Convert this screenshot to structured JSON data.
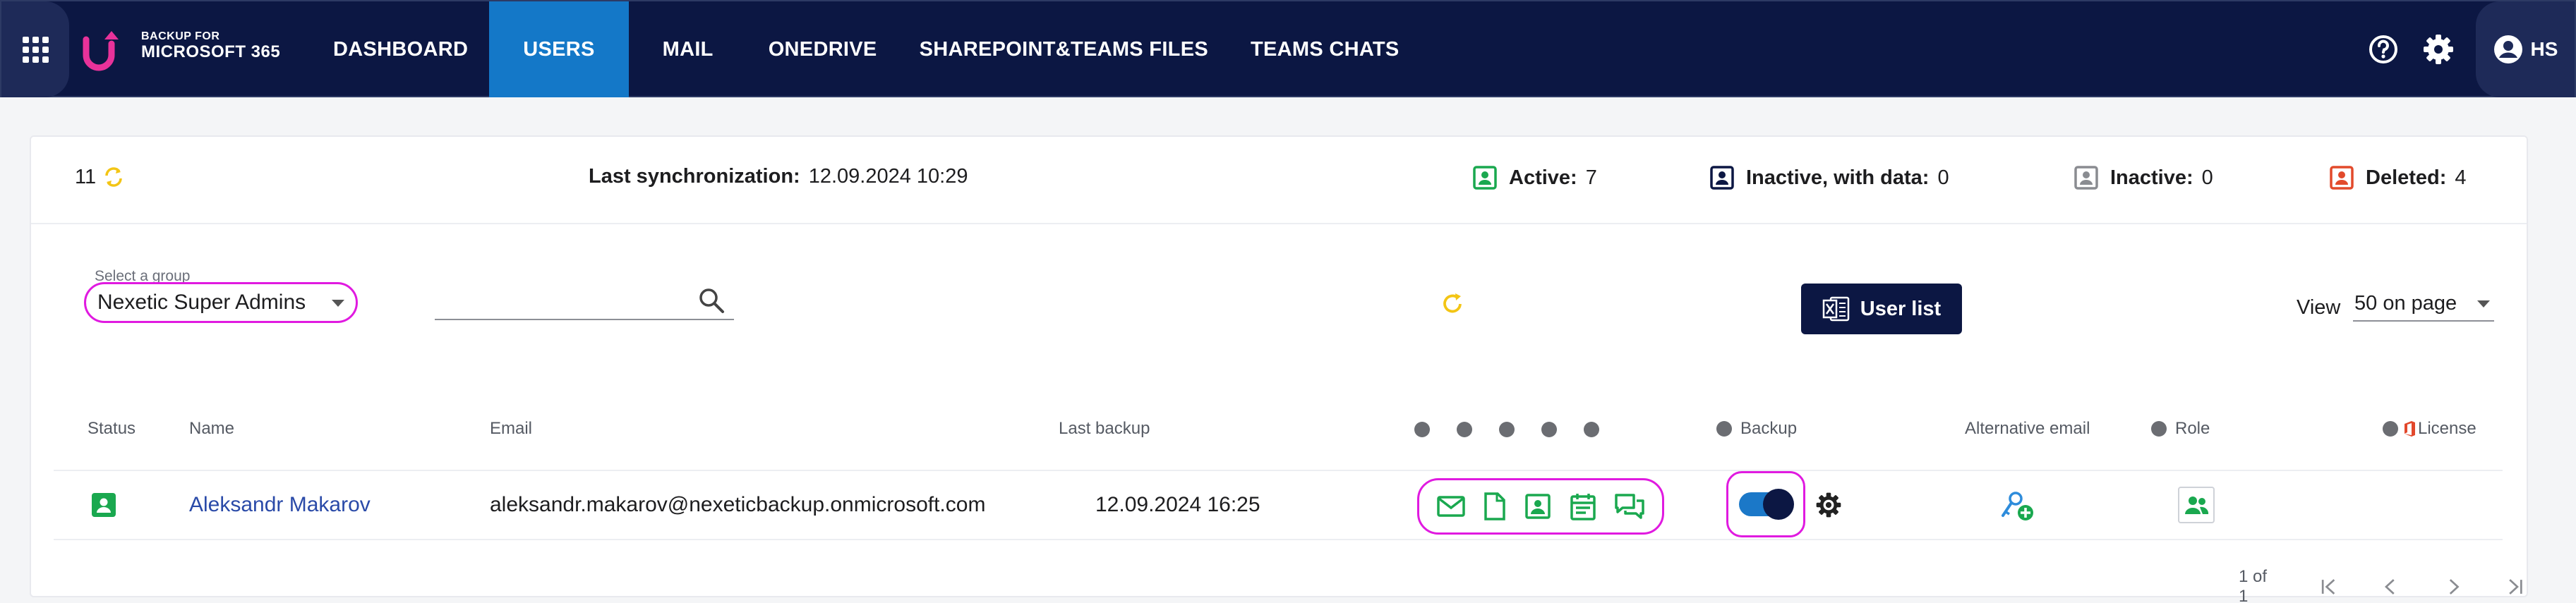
{
  "nav": {
    "brand_line1": "BACKUP FOR",
    "brand_line2": "MICROSOFT 365",
    "items": [
      {
        "label": "DASHBOARD",
        "active": false
      },
      {
        "label": "USERS",
        "active": true
      },
      {
        "label": "MAIL",
        "active": false
      },
      {
        "label": "ONEDRIVE",
        "active": false
      },
      {
        "label": "SHAREPOINT&TEAMS FILES",
        "active": false
      },
      {
        "label": "TEAMS CHATS",
        "active": false
      }
    ],
    "user_initials": "HS",
    "icons": [
      "apps-grid-icon",
      "help-icon",
      "gear-icon",
      "account-circle-icon"
    ]
  },
  "stats": {
    "count": "11",
    "sync_label": "Last synchronization:",
    "sync_value": "12.09.2024 10:29",
    "active_label": "Active:",
    "active_value": "7",
    "inactive_data_label": "Inactive, with data:",
    "inactive_data_value": "0",
    "inactive_label": "Inactive:",
    "inactive_value": "0",
    "deleted_label": "Deleted:",
    "deleted_value": "4"
  },
  "filters": {
    "group_label": "Select a group",
    "group_value": "Nexetic Super Admins",
    "search_value": "",
    "user_list_button": "User list",
    "view_label": "View",
    "view_value": "50 on page"
  },
  "table": {
    "headers": {
      "status": "Status",
      "name": "Name",
      "email": "Email",
      "last_backup": "Last backup",
      "backup": "Backup",
      "alt_email": "Alternative email",
      "role": "Role",
      "license": "License"
    },
    "rows": [
      {
        "name": "Aleksandr Makarov",
        "email": "aleksandr.makarov@nexeticbackup.onmicrosoft.com",
        "last_backup": "12.09.2024 16:25",
        "backup_enabled": true,
        "services": [
          "mail-icon",
          "file-icon",
          "contacts-icon",
          "calendar-icon",
          "chat-icon"
        ]
      }
    ]
  },
  "pager": {
    "text": "1 of 1"
  },
  "colors": {
    "navy": "#0c1743",
    "active_tab": "#1478c8",
    "green": "#1aa84f",
    "red": "#e24a2b",
    "gray": "#8a8c91",
    "yellow": "#f3c515",
    "highlight": "#e01ae0"
  }
}
